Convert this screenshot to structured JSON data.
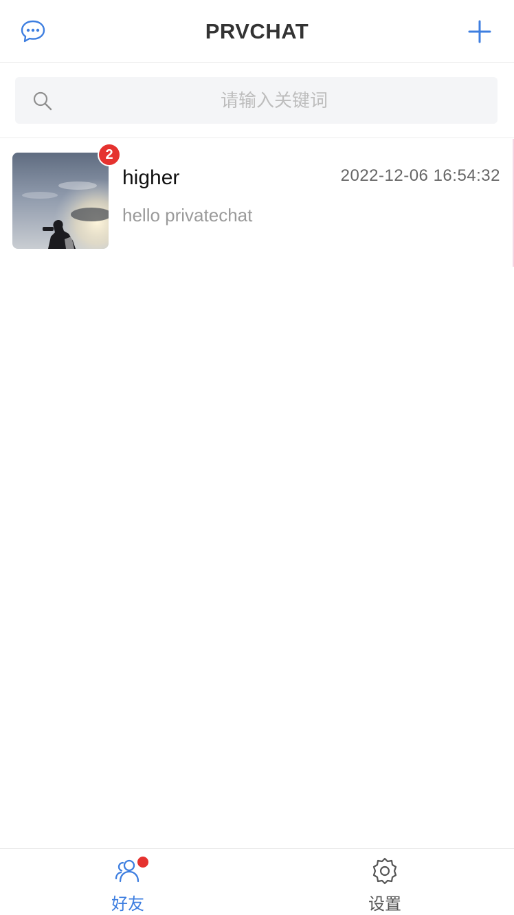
{
  "header": {
    "title": "PRVCHAT",
    "left_icon": "chat-bubble-icon",
    "right_icon": "plus-icon"
  },
  "search": {
    "placeholder": "请输入关键词",
    "value": "",
    "icon": "search-icon"
  },
  "chats": [
    {
      "name": "higher",
      "time": "2022-12-06 16:54:32",
      "last_message": "hello privatechat",
      "unread": "2",
      "avatar": "photo of person silhouette against sky"
    }
  ],
  "tabbar": {
    "items": [
      {
        "label": "好友",
        "icon": "friends-icon",
        "active": true,
        "has_dot": true
      },
      {
        "label": "设置",
        "icon": "gear-icon",
        "active": false,
        "has_dot": false
      }
    ]
  },
  "colors": {
    "accent": "#3d7ee0",
    "badge": "#e5322f",
    "title": "#333333",
    "muted": "#9a9a9a"
  }
}
